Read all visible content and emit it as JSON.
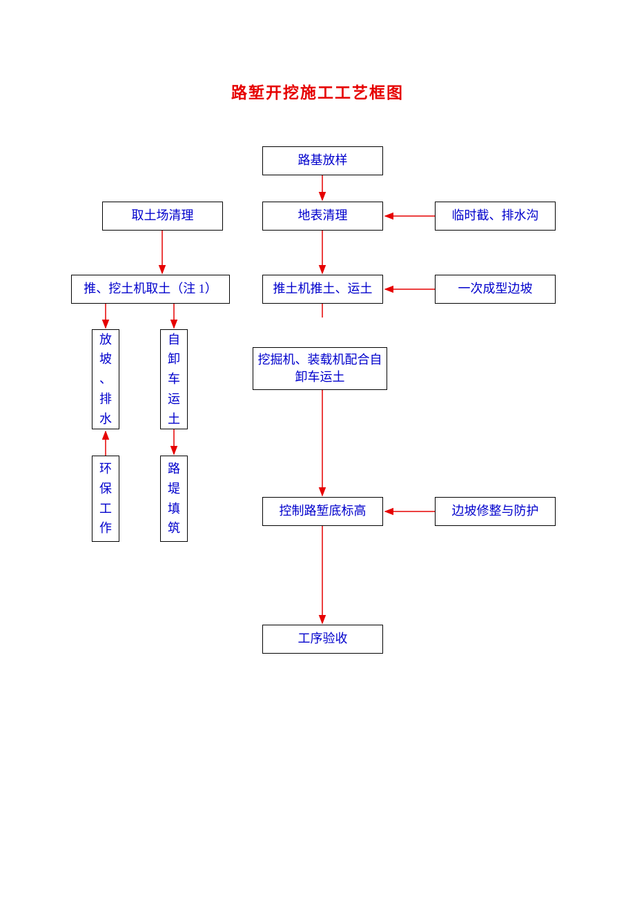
{
  "title": "路堑开挖施工工艺框图",
  "nodes": {
    "roadbed_setout": "路基放样",
    "surface_clear": "地表清理",
    "borrow_pit_clear": "取土场清理",
    "temp_drain": "临时截、排水沟",
    "bulldozer_push": "推土机推土、运土",
    "bulldozer_take_note": "推、挖土机取土（注 1）",
    "slope_once": "一次成型边坡",
    "slope_drain": "放坡、排水",
    "dump_truck": "自卸车运土",
    "excavator_load": "挖掘机、装载机配合自卸车运土",
    "env_protect": "环保工作",
    "embankment_fill": "路堤填筑",
    "control_elev": "控制路堑底标高",
    "slope_trim": "边坡修整与防护",
    "acceptance": "工序验收"
  }
}
